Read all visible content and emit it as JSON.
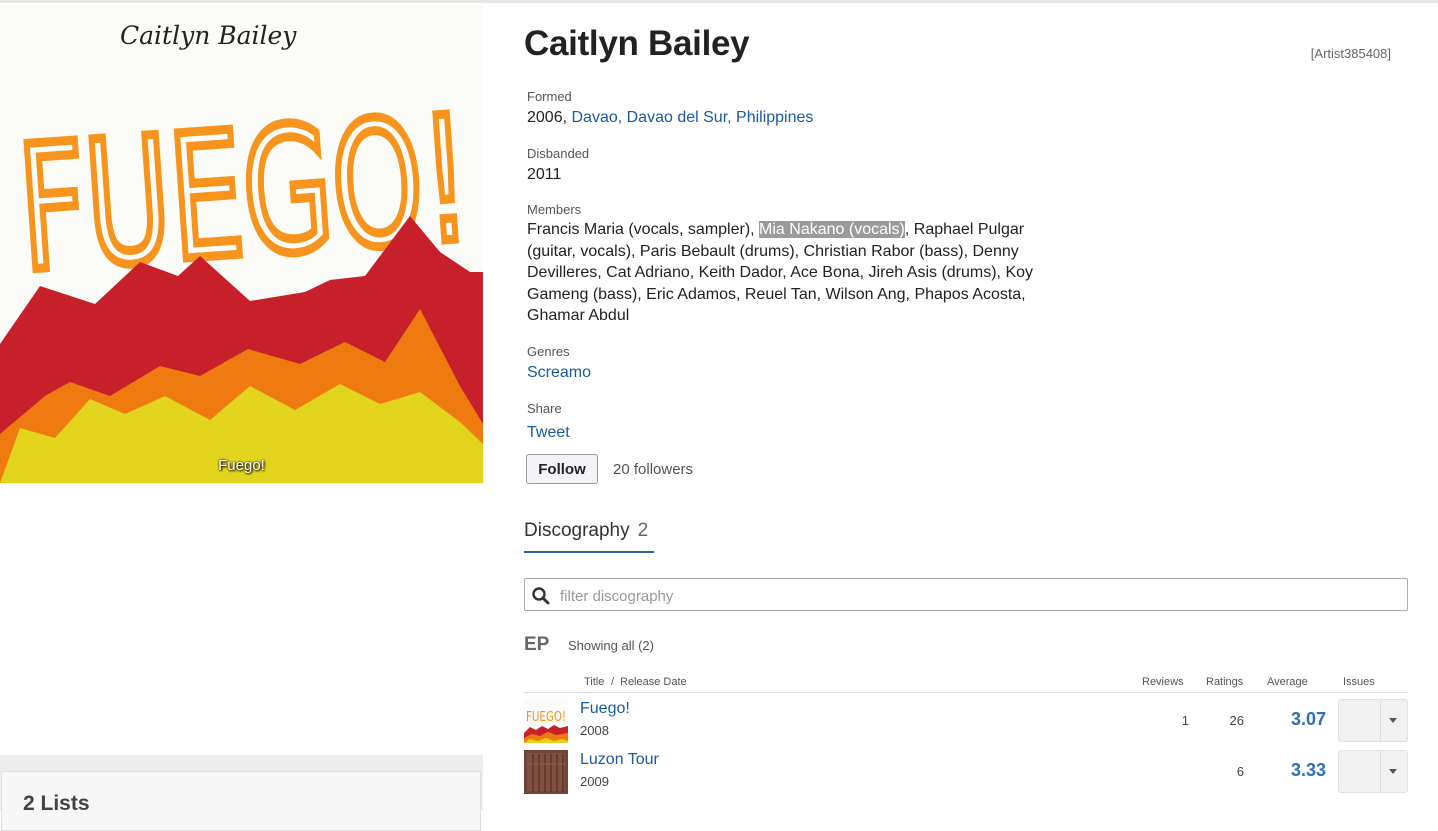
{
  "artist": {
    "name": "Caitlyn Bailey",
    "id": "[Artist385408]"
  },
  "cover": {
    "handwriting_name": "Caitlyn   Bailey",
    "handwriting_title": "FUEGO!",
    "caption": "Fuego!"
  },
  "info": {
    "formed_label": "Formed",
    "formed_year": "2006, ",
    "formed_place": "Davao, Davao del Sur, Philippines",
    "disbanded_label": "Disbanded",
    "disbanded_value": "2011",
    "members_label": "Members",
    "members_before": "Francis Maria (vocals, sampler), ",
    "members_highlight": "Mia Nakano (vocals)",
    "members_after": ", Raphael Pulgar (guitar, vocals), Paris Bebault (drums), Christian Rabor (bass), Denny Devilleres, Cat Adriano, Keith Dador, Ace Bona, Jireh Asis (drums), Koy Gameng (bass), Eric Adamos, Reuel Tan, Wilson Ang, Phapos Acosta, Ghamar Abdul",
    "genres_label": "Genres",
    "genre": "Screamo",
    "share_label": "Share",
    "tweet": "Tweet"
  },
  "follow": {
    "button": "Follow",
    "followers": "20 followers"
  },
  "discography": {
    "tab_label": "Discography",
    "tab_count": "2",
    "filter_placeholder": "filter discography",
    "section_title": "EP",
    "showing": "Showing all (2)",
    "headers": {
      "title": "Title",
      "sep": "/",
      "release_date": "Release Date",
      "reviews": "Reviews",
      "ratings": "Ratings",
      "average": "Average",
      "issues": "Issues"
    },
    "releases": [
      {
        "title": "Fuego!",
        "year": "2008",
        "reviews": "1",
        "ratings": "26",
        "average": "3.07",
        "thumb_text": "FUEGO!"
      },
      {
        "title": "Luzon Tour",
        "year": "2009",
        "reviews": "",
        "ratings": "6",
        "average": "3.33"
      }
    ]
  },
  "lists": {
    "title": "2 Lists"
  },
  "colors": {
    "link": "#1a5aa0",
    "average": "#2f70b0",
    "tab_underline": "#2f5e9a",
    "flame_red": "#c8202a",
    "flame_orange": "#ee7a10",
    "flame_yellow": "#e2d41c",
    "title_orange": "#f6941e"
  }
}
